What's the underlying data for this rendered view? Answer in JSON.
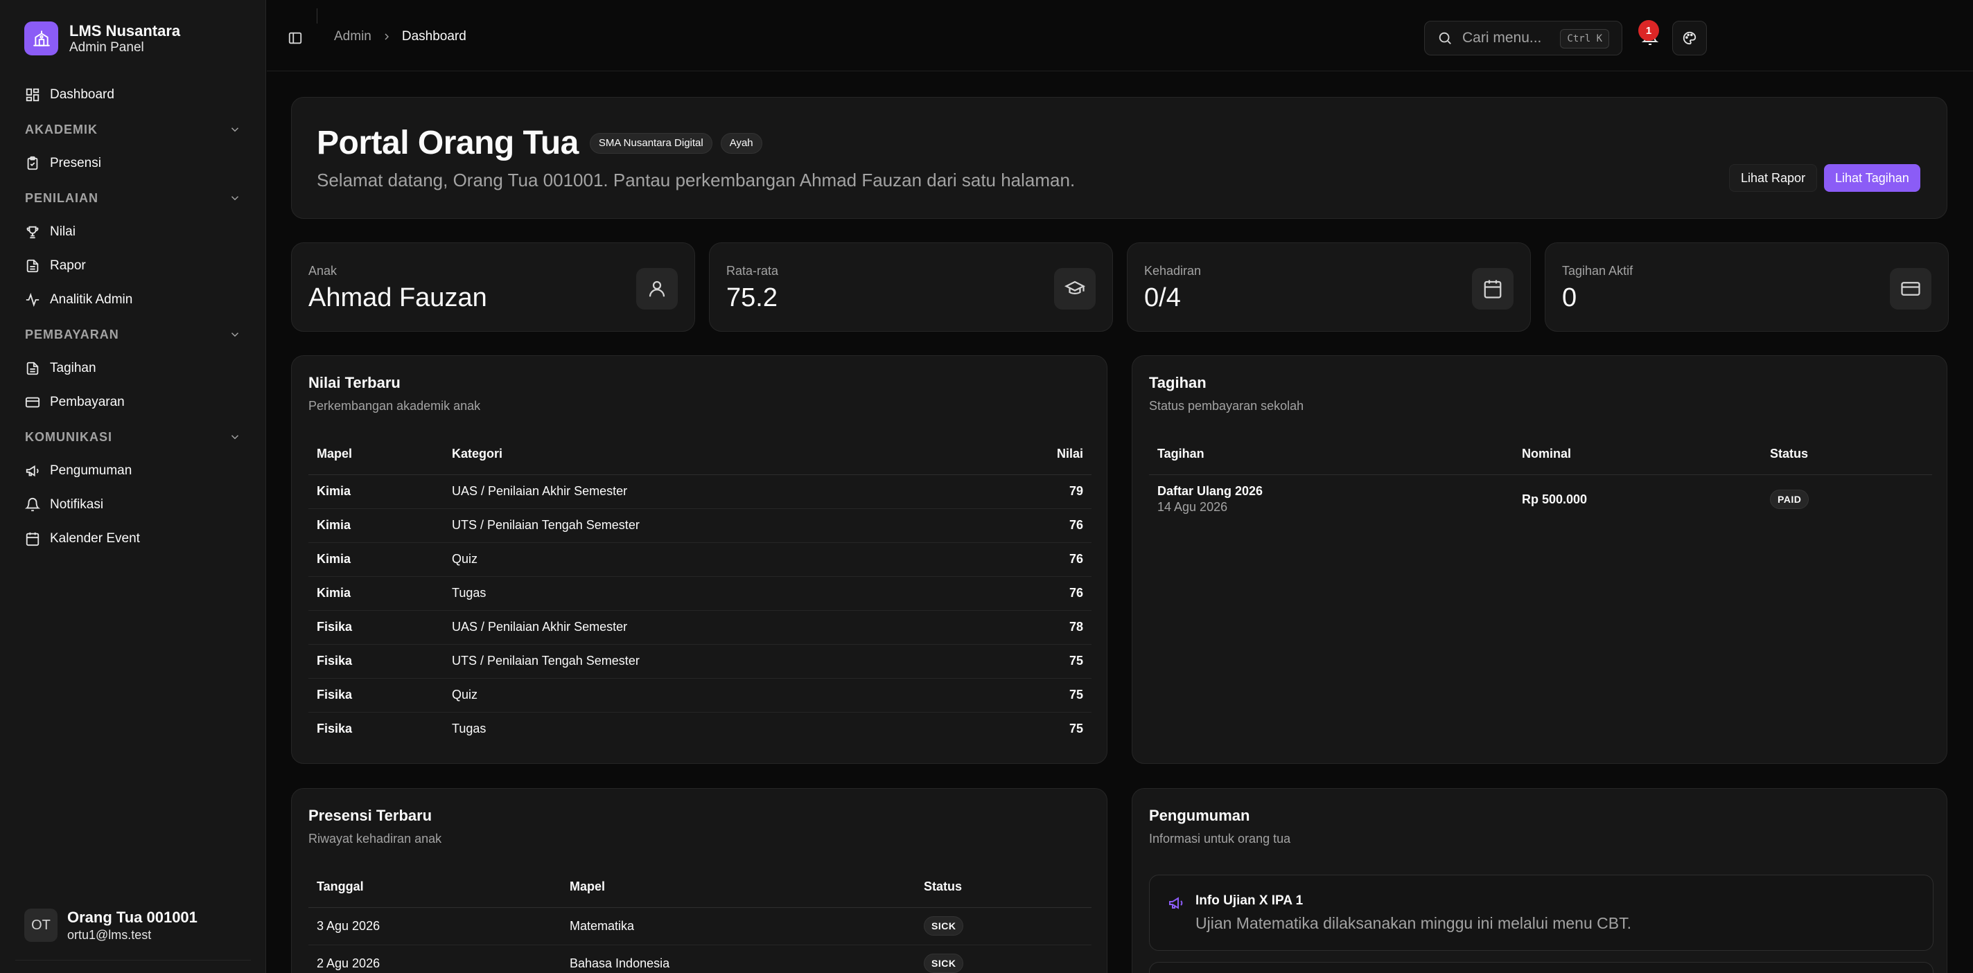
{
  "brand": {
    "name": "LMS Nusantara",
    "subtitle": "Admin Panel"
  },
  "sidebar": {
    "dashboard": "Dashboard",
    "groups": [
      {
        "label": "AKADEMIK",
        "items": [
          "Presensi"
        ]
      },
      {
        "label": "PENILAIAN",
        "items": [
          "Nilai",
          "Rapor",
          "Analitik Admin"
        ]
      },
      {
        "label": "PEMBAYARAN",
        "items": [
          "Tagihan",
          "Pembayaran"
        ]
      },
      {
        "label": "KOMUNIKASI",
        "items": [
          "Pengumuman",
          "Notifikasi",
          "Kalender Event"
        ]
      }
    ],
    "user": {
      "initials": "OT",
      "name": "Orang Tua 001001",
      "email": "ortu1@lms.test"
    }
  },
  "header": {
    "breadcrumb": [
      "Admin",
      "Dashboard"
    ],
    "search_placeholder": "Cari menu...",
    "search_shortcut": "Ctrl K",
    "notification_count": "1"
  },
  "hero": {
    "title": "Portal Orang Tua",
    "badges": [
      "SMA Nusantara Digital",
      "Ayah"
    ],
    "subtitle": "Selamat datang, Orang Tua 001001. Pantau perkembangan Ahmad Fauzan dari satu halaman.",
    "btn_rapor": "Lihat Rapor",
    "btn_tagihan": "Lihat Tagihan"
  },
  "stats": [
    {
      "label": "Anak",
      "value": "Ahmad Fauzan",
      "icon": "user-icon"
    },
    {
      "label": "Rata-rata",
      "value": "75.2",
      "icon": "graduation-cap-icon"
    },
    {
      "label": "Kehadiran",
      "value": "0/4",
      "icon": "calendar-icon"
    },
    {
      "label": "Tagihan Aktif",
      "value": "0",
      "icon": "credit-card-icon"
    }
  ],
  "grades": {
    "title": "Nilai Terbaru",
    "subtitle": "Perkembangan akademik anak",
    "columns": [
      "Mapel",
      "Kategori",
      "Nilai"
    ],
    "rows": [
      [
        "Kimia",
        "UAS / Penilaian Akhir Semester",
        "79"
      ],
      [
        "Kimia",
        "UTS / Penilaian Tengah Semester",
        "76"
      ],
      [
        "Kimia",
        "Quiz",
        "76"
      ],
      [
        "Kimia",
        "Tugas",
        "76"
      ],
      [
        "Fisika",
        "UAS / Penilaian Akhir Semester",
        "78"
      ],
      [
        "Fisika",
        "UTS / Penilaian Tengah Semester",
        "75"
      ],
      [
        "Fisika",
        "Quiz",
        "75"
      ],
      [
        "Fisika",
        "Tugas",
        "75"
      ]
    ]
  },
  "bills": {
    "title": "Tagihan",
    "subtitle": "Status pembayaran sekolah",
    "columns": [
      "Tagihan",
      "Nominal",
      "Status"
    ],
    "rows": [
      {
        "name": "Daftar Ulang 2026",
        "date": "14 Agu 2026",
        "amount": "Rp 500.000",
        "status": "PAID"
      }
    ]
  },
  "attendance": {
    "title": "Presensi Terbaru",
    "subtitle": "Riwayat kehadiran anak",
    "columns": [
      "Tanggal",
      "Mapel",
      "Status"
    ],
    "rows": [
      [
        "3 Agu 2026",
        "Matematika",
        "SICK"
      ],
      [
        "2 Agu 2026",
        "Bahasa Indonesia",
        "SICK"
      ]
    ]
  },
  "announcements": {
    "title": "Pengumuman",
    "subtitle": "Informasi untuk orang tua",
    "items": [
      {
        "title": "Info Ujian X IPA 1",
        "body": "Ujian Matematika dilaksanakan minggu ini melalui menu CBT."
      }
    ]
  },
  "colors": {
    "accent": "#8b5cf6",
    "badge": "#dc2626",
    "background": "#0a0a0a",
    "card": "#171717"
  }
}
